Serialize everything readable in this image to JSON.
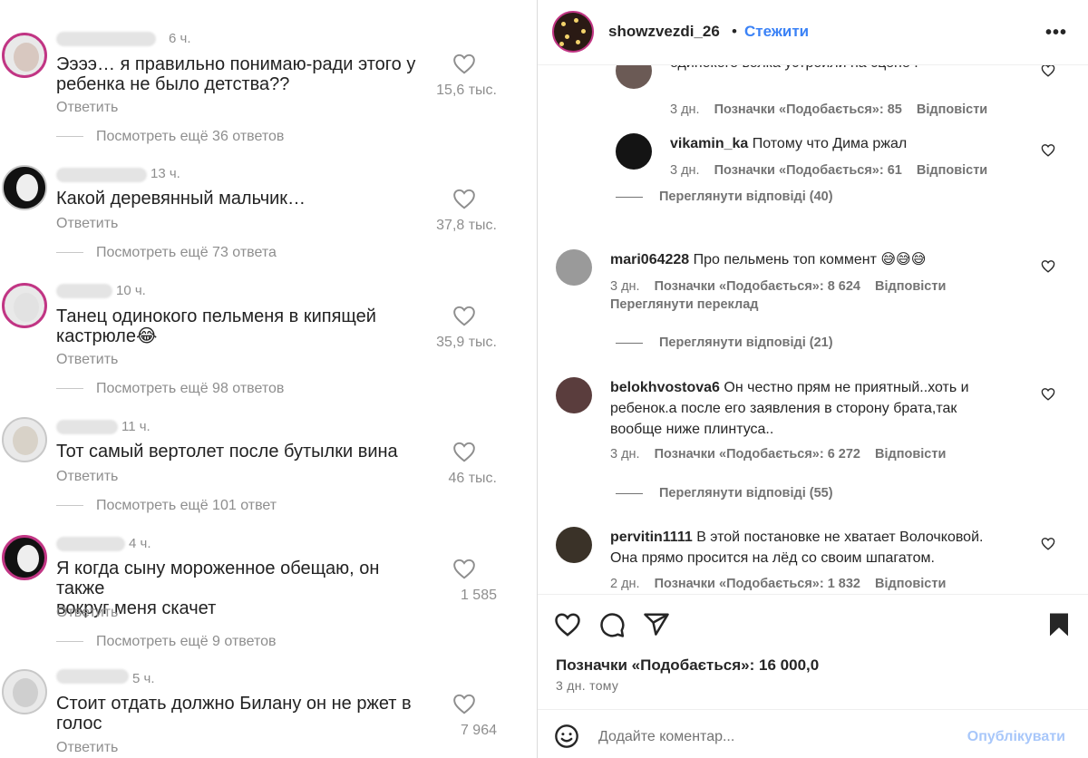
{
  "left_comments": [
    {
      "time": "6 ч.",
      "text_lines": [
        "Ээээ… я правильно понимаю-ради этого у",
        "ребенка не было детства??"
      ],
      "reply": "Ответить",
      "more": "Посмотреть ещё 36 ответов",
      "likes": "15,6 тыс."
    },
    {
      "time": "13 ч.",
      "text_lines": [
        "Какой деревянный мальчик…"
      ],
      "reply": "Ответить",
      "more": "Посмотреть ещё 73 ответа",
      "likes": "37,8 тыс."
    },
    {
      "time": "10 ч.",
      "text_lines": [
        "Танец одинокого пельменя в кипящей",
        "кастрюле😂"
      ],
      "reply": "Ответить",
      "more": "Посмотреть ещё 98 ответов",
      "likes": "35,9 тыс."
    },
    {
      "time": "11 ч.",
      "text_lines": [
        "Тот самый вертолет после бутылки вина"
      ],
      "reply": "Ответить",
      "more": "Посмотреть ещё 101 ответ",
      "likes": "46 тыс."
    },
    {
      "time": "4 ч.",
      "text_lines": [
        "Я когда сыну мороженное обещаю, он также",
        "вокруг меня скачет"
      ],
      "reply": "Ответить",
      "more": "Посмотреть ещё 9 ответов",
      "likes": "1 585"
    },
    {
      "time": "5 ч.",
      "text_lines": [
        "Стоит отдать должно Билану он не ржет в",
        "голос"
      ],
      "reply": "Ответить",
      "more": "",
      "likes": "7 964"
    }
  ],
  "post": {
    "username": "showzvezdi_26",
    "separator": "•",
    "follow_label": "Стежити",
    "menu_label": "•••"
  },
  "right_comments": [
    {
      "user": "",
      "text_lines": [
        "",
        "одинокого волка устроили на сцене ."
      ],
      "time": "3 дн.",
      "likes": "Позначки «Подобається»: 85",
      "reply": "Відповісти",
      "translate": ""
    },
    {
      "user": "vikamin_ka",
      "text_lines": [
        "Потому что Дима ржал"
      ],
      "time": "3 дн.",
      "likes": "Позначки «Подобається»: 61",
      "reply": "Відповісти",
      "translate": ""
    },
    {
      "user": "mari064228",
      "text_lines": [
        "Про пельмень топ коммент 😅😅😅"
      ],
      "time": "3 дн.",
      "likes": "Позначки «Подобається»: 8 624",
      "reply": "Відповісти",
      "translate": "Переглянути переклад"
    },
    {
      "user": "belokhvostova6",
      "text_lines": [
        "Он честно прям не приятный..хоть и",
        "ребенок.а после его заявления в сторону брата,так",
        "вообще ниже плинтуса.."
      ],
      "time": "3 дн.",
      "likes": "Позначки «Подобається»: 6 272",
      "reply": "Відповісти",
      "translate": ""
    },
    {
      "user": "pervitin1111",
      "text_lines": [
        "В этой постановке не хватает Волочковой.",
        "Она прямо просится на лёд со своим шпагатом."
      ],
      "time": "2 дн.",
      "likes": "Позначки «Подобається»: 1 832",
      "reply": "Відповісти",
      "translate": ""
    }
  ],
  "view_replies": [
    "Переглянути відповіді (40)",
    "Переглянути відповіді (21)",
    "Переглянути відповіді (55)"
  ],
  "actions": {
    "likes_total": "Позначки «Подобається»: 16 000,0",
    "posted_ago": "3 дн. тому",
    "comment_placeholder": "Додайте коментар...",
    "publish_label": "Опублікувати"
  },
  "icons": [
    "heart-icon",
    "comment-icon",
    "share-icon",
    "bookmark-icon",
    "emoji-icon",
    "more-icon"
  ],
  "colors": {
    "accent": "#3b82f6",
    "publish_disabled": "#a8c7fa",
    "muted": "#737373",
    "avatar_ring": "#c13584"
  }
}
